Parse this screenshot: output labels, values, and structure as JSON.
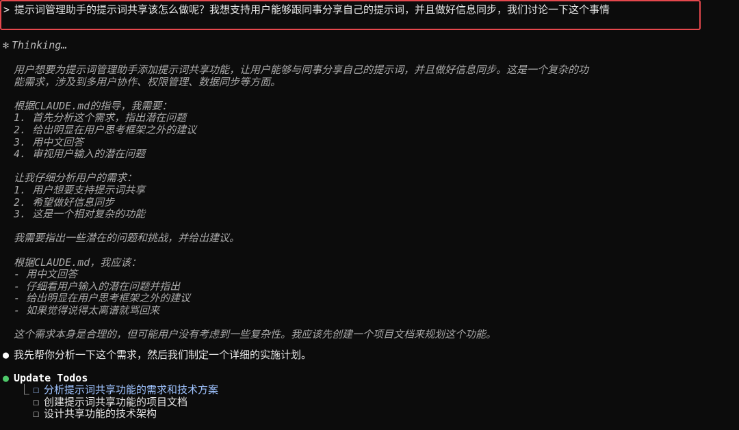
{
  "prompt": {
    "marker": ">",
    "text": "提示词管理助手的提示词共享该怎么做呢？我想支持用户能够跟同事分享自己的提示词，并且做好信息同步，我们讨论一下这个事情"
  },
  "thinking": {
    "spinner": "✻",
    "label": "Thinking…",
    "lines": [
      "用户想要为提示词管理助手添加提示词共享功能，让用户能够与同事分享自己的提示词，并且做好信息同步。这是一个复杂的功",
      "能需求，涉及到多用户协作、权限管理、数据同步等方面。",
      "",
      "根据CLAUDE.md的指导，我需要：",
      "1. 首先分析这个需求，指出潜在问题",
      "2. 给出明显在用户思考框架之外的建议",
      "3. 用中文回答",
      "4. 审视用户输入的潜在问题",
      "",
      "让我仔细分析用户的需求：",
      "1. 用户想要支持提示词共享",
      "2. 希望做好信息同步",
      "3. 这是一个相对复杂的功能",
      "",
      "我需要指出一些潜在的问题和挑战，并给出建议。",
      "",
      "根据CLAUDE.md，我应该：",
      "- 用中文回答",
      "- 仔细看用户输入的潜在问题并指出",
      "- 给出明显在用户思考框架之外的建议",
      "- 如果觉得说得太离谱就骂回来",
      "",
      "这个需求本身是合理的，但可能用户没有考虑到一些复杂性。我应该先创建一个项目文档来规划这个功能。"
    ]
  },
  "answer": {
    "bullet": "●",
    "text": "我先帮你分析一下这个需求，然后我们制定一个详细的实施计划。"
  },
  "todos": {
    "bullet": "●",
    "title": "Update Todos",
    "branch": "⎿",
    "checkbox": "☐",
    "items": [
      {
        "label": "分析提示词共享功能的需求和技术方案",
        "active": true
      },
      {
        "label": "创建提示词共享功能的项目文档",
        "active": false
      },
      {
        "label": "设计共享功能的技术架构",
        "active": false
      }
    ]
  },
  "colors": {
    "background": "#0c0c0c",
    "highlight_border": "#e5484d",
    "todo_bullet": "#4ec96a",
    "active_todo": "#9fc3ff"
  }
}
